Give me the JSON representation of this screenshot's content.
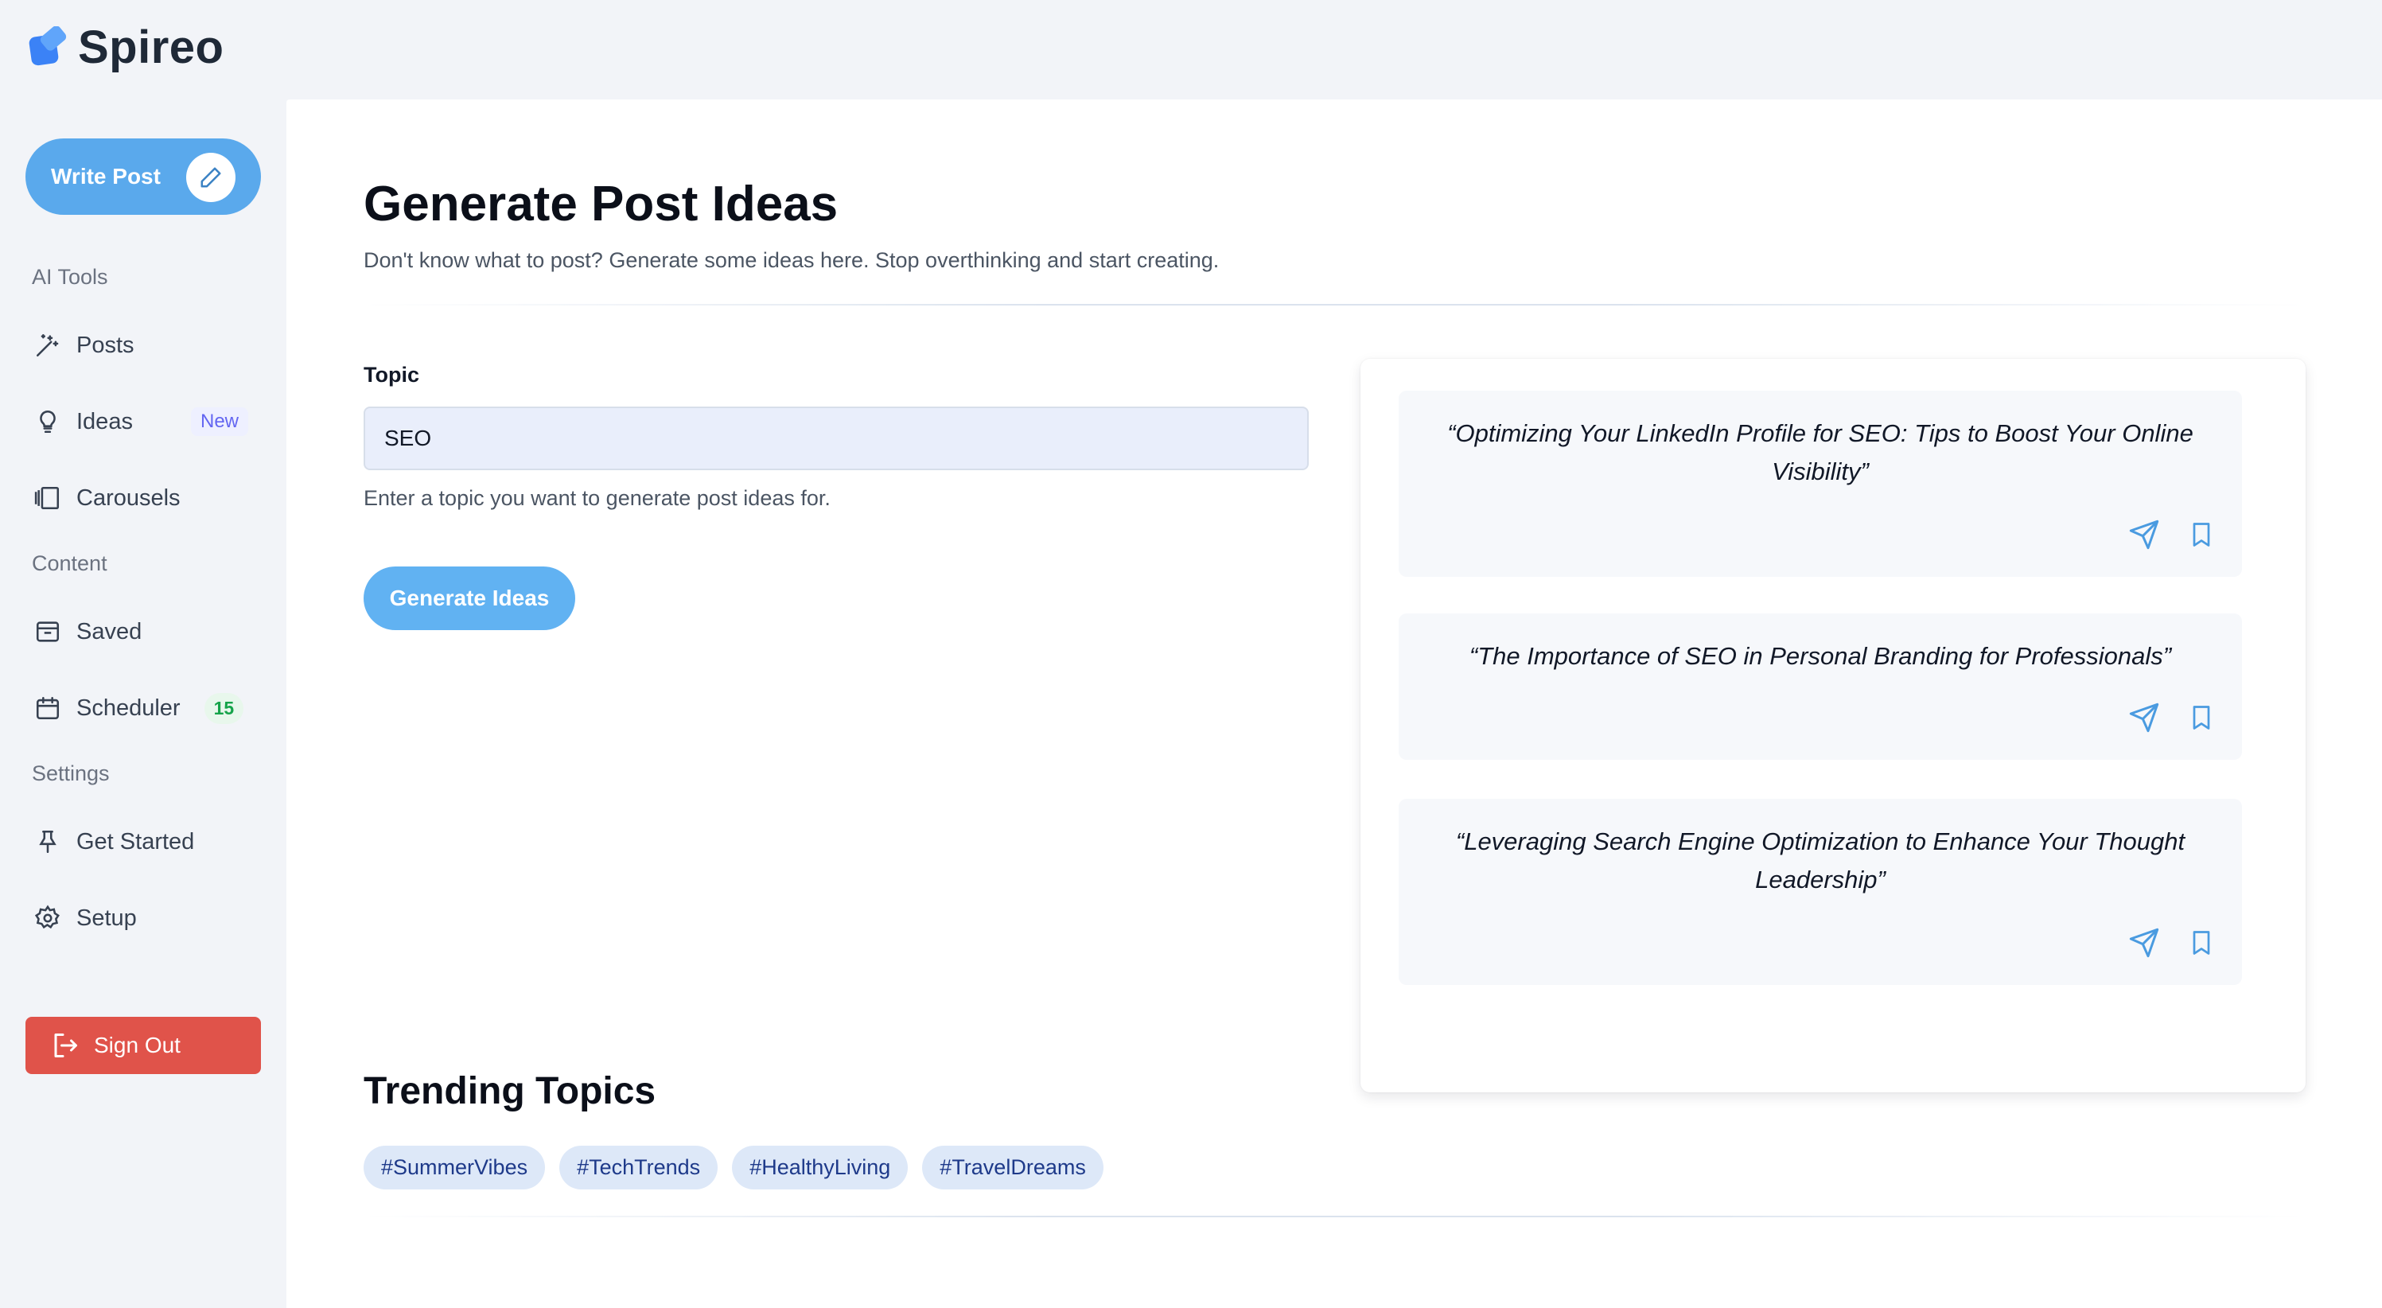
{
  "app": {
    "name": "Spireo",
    "accent": "#5aa9ec"
  },
  "sidebar": {
    "write_post_label": "Write Post",
    "sections": {
      "ai_tools": "AI Tools",
      "content": "Content",
      "settings": "Settings"
    },
    "items": {
      "posts": {
        "label": "Posts",
        "icon": "magic-wand-icon"
      },
      "ideas": {
        "label": "Ideas",
        "badge": "New",
        "icon": "lightbulb-icon"
      },
      "carousels": {
        "label": "Carousels",
        "icon": "carousel-icon"
      },
      "saved": {
        "label": "Saved",
        "icon": "inbox-icon"
      },
      "scheduler": {
        "label": "Scheduler",
        "badge": "15",
        "icon": "calendar-icon"
      },
      "get_started": {
        "label": "Get Started",
        "icon": "pin-icon"
      },
      "setup": {
        "label": "Setup",
        "icon": "gear-icon"
      }
    },
    "sign_out_label": "Sign Out",
    "sign_out_color": "#e0534a"
  },
  "main": {
    "title": "Generate Post Ideas",
    "subtitle": "Don't know what to post? Generate some ideas here. Stop overthinking and start creating.",
    "topic_label": "Topic",
    "topic_value": "SEO",
    "topic_helper": "Enter a topic you want to generate post ideas for.",
    "generate_label": "Generate Ideas",
    "ideas": [
      {
        "text": "“Optimizing Your LinkedIn Profile for SEO: Tips to Boost Your Online Visibility”"
      },
      {
        "text": "“The Importance of SEO in Personal Branding for Professionals”"
      },
      {
        "text": "“Leveraging Search Engine Optimization to Enhance Your Thought Leadership”"
      }
    ],
    "trending_title": "Trending Topics",
    "trending_tags": [
      "#SummerVibes",
      "#TechTrends",
      "#HealthyLiving",
      "#TravelDreams"
    ]
  }
}
